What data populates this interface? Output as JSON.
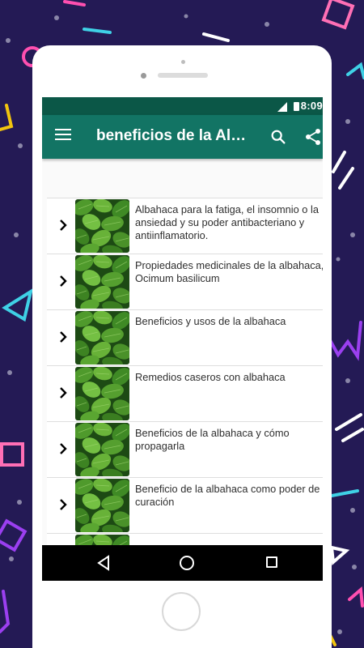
{
  "status": {
    "time": "8:09"
  },
  "appbar": {
    "title": "beneficios de la Albahaca"
  },
  "list": {
    "items": [
      {
        "label": "Albahaca para la fatiga, el insomnio o la ansiedad y su poder antibacteriano y antiinflamatorio."
      },
      {
        "label": "Propiedades medicinales de la albahaca, Ocimum basilicum"
      },
      {
        "label": "Beneficios y usos de la albahaca"
      },
      {
        "label": "Remedios caseros con albahaca"
      },
      {
        "label": "Beneficios de la albahaca y cómo propagarla"
      },
      {
        "label": "Beneficio de la albahaca como poder de curación"
      },
      {
        "label": ""
      }
    ]
  },
  "icons": {
    "menu": "menu-icon",
    "search": "search-icon",
    "share": "share-icon",
    "chevron": "chevron-right-icon",
    "back": "nav-back-icon",
    "home": "nav-home-icon",
    "recent": "nav-recents-icon"
  },
  "colors": {
    "status_bar": "#0b5747",
    "app_bar": "#127464",
    "background": "#241a55"
  }
}
